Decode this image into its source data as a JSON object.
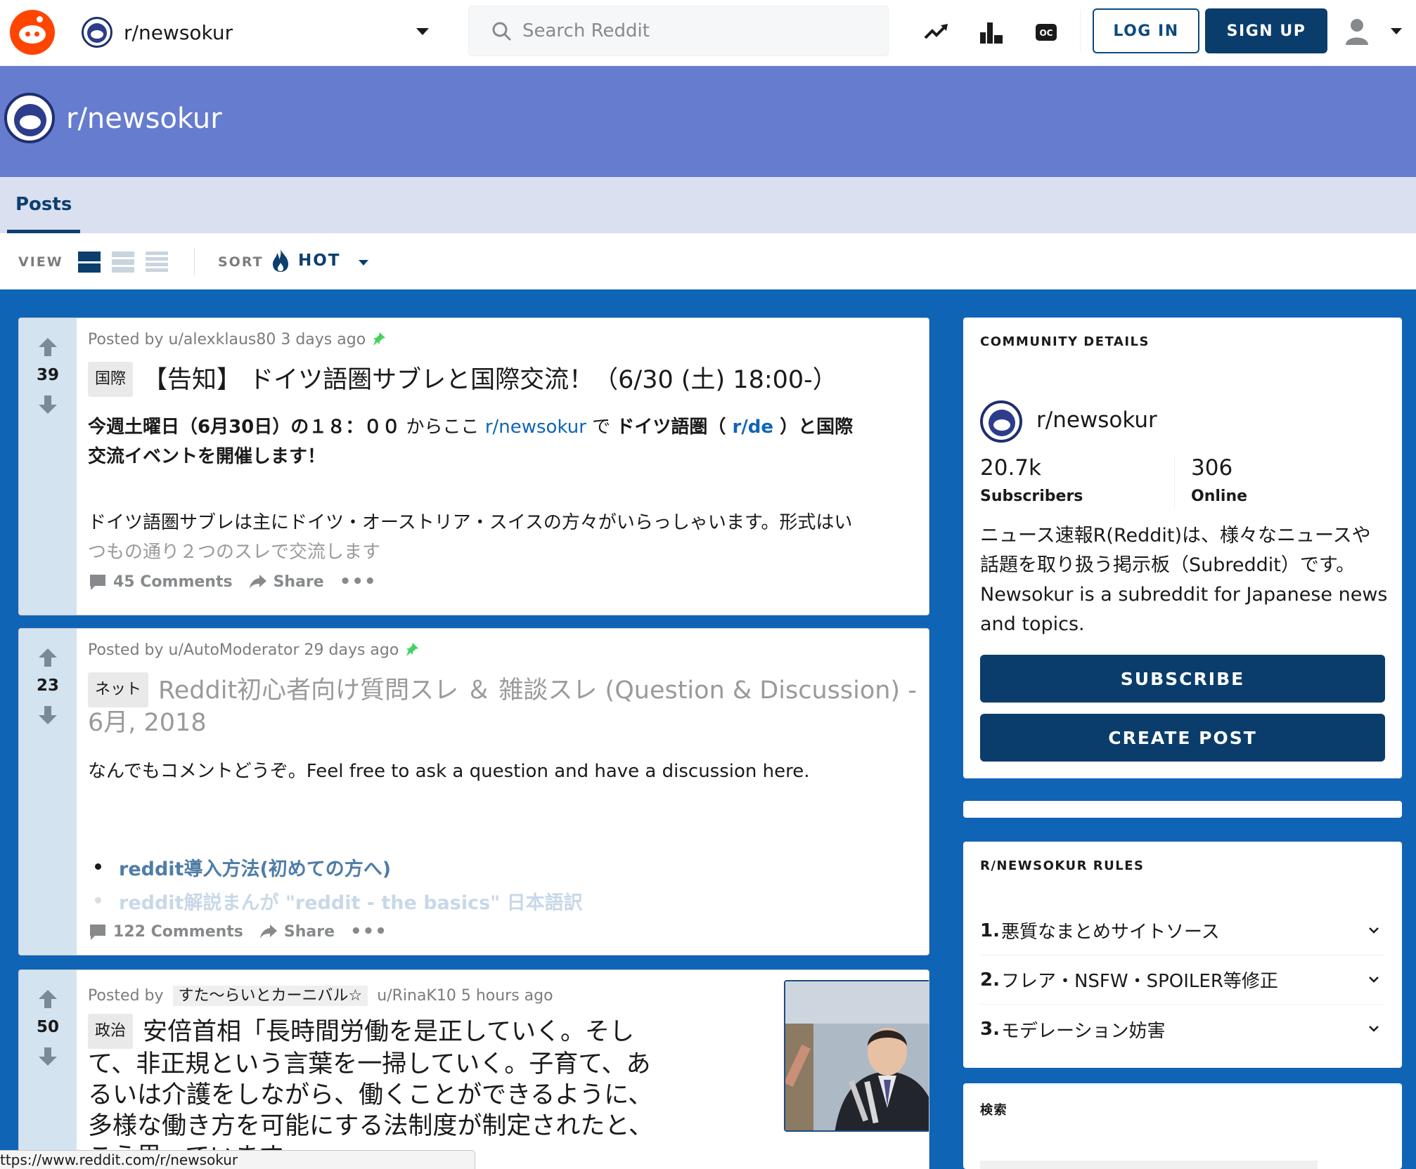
{
  "topnav": {
    "subreddit": "r/newsokur",
    "search_placeholder": "Search Reddit",
    "login": "LOG IN",
    "signup": "SIGN UP",
    "icons": [
      "trending-icon",
      "leaderboard-icon",
      "oc-icon",
      "user-icon"
    ]
  },
  "banner": {
    "title": "r/newsokur",
    "color": "#657ccf"
  },
  "tabs": {
    "posts": "Posts"
  },
  "sortbar": {
    "view_label": "VIEW",
    "sort_label": "SORT",
    "sort_value": "HOT"
  },
  "posts": [
    {
      "score": "39",
      "meta": "Posted by u/alexklaus80 3 days ago",
      "flair": "国際",
      "title": "【告知】 ドイツ語圏サブレと国際交流！（6/30 (土) 18:00-）",
      "body1_a": "今週土曜日（6月30日）の１８：００",
      "body1_b": " からここ ",
      "body1_c": "r/newsokur",
      "body1_d": " で ",
      "body1_e": "ドイツ語圏（",
      "body1_f": " r/de ",
      "body1_g": "）と国際",
      "body1_h": "交流イベントを開催します！",
      "body2_a": "ドイツ語圏サブレは主にドイツ・オーストリア・スイスの方々がいらっしゃいます。形式はい",
      "body2_b": "つもの通り２つのスレで交流します",
      "comments": "45 Comments",
      "share": "Share"
    },
    {
      "score": "23",
      "meta": "Posted by u/AutoModerator 29 days ago",
      "flair": "ネット",
      "title": "Reddit初心者向け質問スレ ＆ 雑談スレ (Question & Discussion) - 6月, 2018",
      "body": "なんでもコメントどうぞ。Feel free to ask a question and have a discussion here.",
      "links": [
        "reddit導入方法(初めての方へ)",
        "reddit解説まんが \"reddit - the basics\" 日本語訳"
      ],
      "comments": "122 Comments",
      "share": "Share"
    },
    {
      "score": "50",
      "meta_prefix": "Posted by",
      "user_flair": "すた〜らいとカーニバル☆",
      "meta_suffix": "u/RinaK10 5 hours ago",
      "flair": "政治",
      "title": "安倍首相「長時間労働を是正していく。そして、非正規という言葉を一掃していく。子育て、あるいは介護をしながら、働くことができるように、多様な働き方を可能にする法制度が制定されたと、こう思っています"
    }
  ],
  "sidebar": {
    "details_head": "COMMUNITY DETAILS",
    "name": "r/newsokur",
    "subscribers": "20.7k",
    "subscribers_label": "Subscribers",
    "online": "306",
    "online_label": "Online",
    "description": "ニュース速報R(Reddit)は、様々なニュースや話題を取り扱う掲示板（Subreddit）です。Newsokur is a subreddit for Japanese news and topics.",
    "subscribe": "SUBSCRIBE",
    "create_post": "CREATE POST",
    "rules_head": "R/NEWSOKUR RULES",
    "rules": [
      {
        "num": "1.",
        "text": "悪質なまとめサイトソース"
      },
      {
        "num": "2.",
        "text": "フレア・NSFW・SPOILER等修正"
      },
      {
        "num": "3.",
        "text": "モデレーション妨害"
      }
    ],
    "search_head": "検索"
  },
  "statusbar": "ttps://www.reddit.com/r/newsokur",
  "colors": {
    "page_bg": "#1064b6",
    "button": "#0a3d6b",
    "vote_col": "#d4e3f0",
    "orange": "#ff4500"
  }
}
